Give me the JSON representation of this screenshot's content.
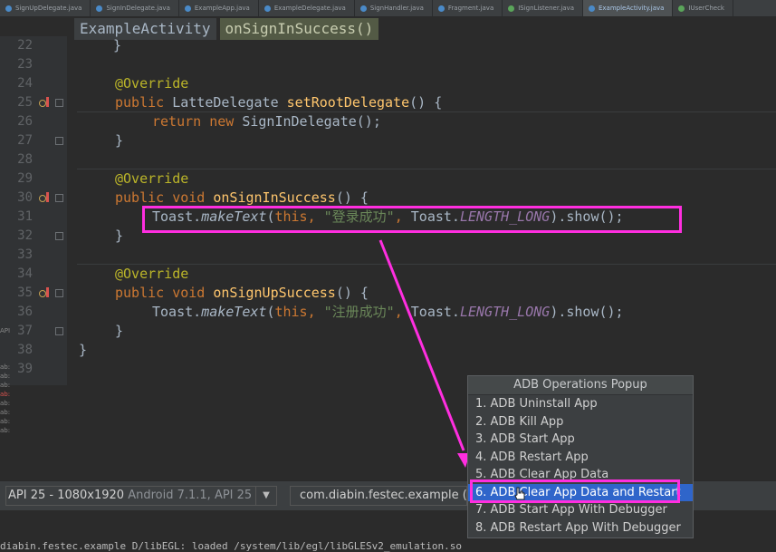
{
  "tabs": [
    {
      "label": "SignUpDelegate.java",
      "active": false
    },
    {
      "label": "SignInDelegate.java",
      "active": false
    },
    {
      "label": "ExampleApp.java",
      "active": false
    },
    {
      "label": "ExampleDelegate.java",
      "active": false
    },
    {
      "label": "SignHandler.java",
      "active": false
    },
    {
      "label": "Fragment.java",
      "active": false
    },
    {
      "label": "ISignListener.java",
      "active": false
    },
    {
      "label": "ExampleActivity.java",
      "active": true
    },
    {
      "label": "IUserCheck",
      "active": false
    }
  ],
  "breadcrumb": {
    "class_name": "ExampleActivity",
    "method_name": "onSignInSuccess()"
  },
  "line_numbers": [
    "22",
    "23",
    "24",
    "25",
    "26",
    "27",
    "28",
    "29",
    "30",
    "31",
    "32",
    "33",
    "34",
    "35",
    "36",
    "37",
    "38",
    "39"
  ],
  "code": {
    "l22_brace": "}",
    "override": "@Override",
    "public": "public",
    "void": "void",
    "l25_type": "LatteDelegate",
    "l25_method": "setRootDelegate",
    "l25_tail": "() {",
    "l26_return": "return",
    "l26_new": "new",
    "l26_call": "SignInDelegate();",
    "close_brace": "}",
    "l30_method": "onSignInSuccess",
    "l30_tail": "() {",
    "toast": "Toast.",
    "make_text": "makeText",
    "open_paren": "(",
    "this": "this",
    "comma": ", ",
    "l31_string": "\"登录成功\"",
    "comma2": ", ",
    "toast2": "Toast.",
    "length_long": "LENGTH_LONG",
    "show": ").show();",
    "l35_method": "onSignUpSuccess",
    "l35_tail": "() {",
    "l36_string": "\"注册成功\"",
    "l38_brace": "}"
  },
  "left_strip": [
    "API",
    "ab:",
    "ab:",
    "ab:",
    "ab:",
    "ab:",
    "ab:",
    "ab:",
    "ab:",
    "ab:",
    "ab:"
  ],
  "run_config": {
    "device_main": "API 25 - 1080x1920",
    "device_sub": "Android 7.1.1, API 25",
    "process": "com.diabin.festec.example ("
  },
  "log_text": "diabin.festec.example D/libEGL: loaded /system/lib/egl/libGLESv2_emulation.so",
  "popup": {
    "title": "ADB Operations Popup",
    "items": [
      "1. ADB Uninstall App",
      "2. ADB Kill App",
      "3. ADB Start App",
      "4. ADB Restart App",
      "5. ADB Clear App Data",
      "6. ADB Clear App Data and Restart",
      "7. ADB Start App With Debugger",
      "8. ADB Restart App With Debugger"
    ],
    "selected_index": 5
  },
  "colors": {
    "highlight": "#ff2ee0",
    "selection": "#2f65ca"
  },
  "icons": {
    "override_marker": "override-marker-icon",
    "fold": "fold-icon",
    "dropdown": "chevron-down-icon",
    "cursor": "hand-cursor-icon"
  }
}
